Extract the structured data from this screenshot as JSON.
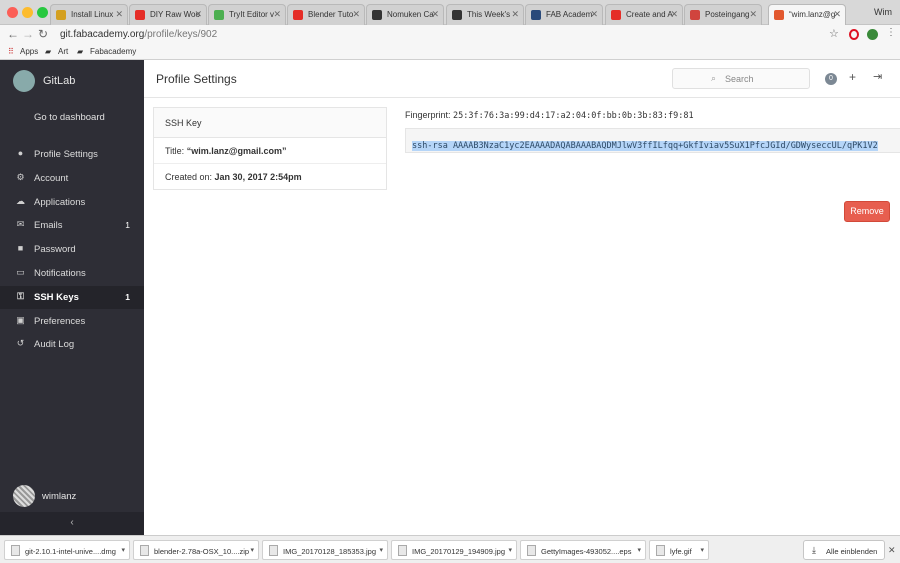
{
  "browser": {
    "tabs": [
      {
        "label": "Install Linux",
        "fav": "#d4a020"
      },
      {
        "label": "DIY Raw Woo",
        "fav": "#e52d27"
      },
      {
        "label": "TryIt Editor v",
        "fav": "#4caf50"
      },
      {
        "label": "Blender Tuto",
        "fav": "#e52d27"
      },
      {
        "label": "Nomuken Ca",
        "fav": "#333333"
      },
      {
        "label": "This Week's",
        "fav": "#333333"
      },
      {
        "label": "FAB Academ",
        "fav": "#2a4a7a"
      },
      {
        "label": "Create and A",
        "fav": "#e52d27"
      },
      {
        "label": "Posteingang",
        "fav": "#d0443e"
      },
      {
        "label": "“wim.lanz@g",
        "fav": "#e2582e"
      }
    ],
    "user": "Wim",
    "url_host": "git.fabacademy.org",
    "url_path": "/profile/keys/902",
    "bookmarks": [
      "Apps",
      "Art",
      "Fabacademy"
    ]
  },
  "sidebar": {
    "brand": "GitLab",
    "dashboard": "Go to dashboard",
    "items": [
      {
        "label": "Profile Settings",
        "icon": "user-icon",
        "glyph": "●",
        "badge": ""
      },
      {
        "label": "Account",
        "icon": "gear-icon",
        "glyph": "⚙",
        "badge": ""
      },
      {
        "label": "Applications",
        "icon": "cloud-icon",
        "glyph": "☁",
        "badge": ""
      },
      {
        "label": "Emails",
        "icon": "envelope-icon",
        "glyph": "✉",
        "badge": "1"
      },
      {
        "label": "Password",
        "icon": "lock-icon",
        "glyph": "■",
        "badge": ""
      },
      {
        "label": "Notifications",
        "icon": "inbox-icon",
        "glyph": "▭",
        "badge": ""
      },
      {
        "label": "SSH Keys",
        "icon": "key-icon",
        "glyph": "⚿",
        "badge": "1"
      },
      {
        "label": "Preferences",
        "icon": "image-icon",
        "glyph": "▣",
        "badge": ""
      },
      {
        "label": "Audit Log",
        "icon": "history-icon",
        "glyph": "↺",
        "badge": ""
      }
    ],
    "active_index": 6,
    "username": "wimlanz",
    "collapse": "‹"
  },
  "header": {
    "title": "Profile Settings",
    "search_placeholder": "Search",
    "todo_count": "0"
  },
  "ssh_key": {
    "panel_title": "SSH Key",
    "title_label": "Title:",
    "title_value": "“wim.lanz@gmail.com”",
    "created_label": "Created on:",
    "created_value": "Jan 30, 2017 2:54pm",
    "fingerprint_label": "Fingerprint:",
    "fingerprint": "25:3f:76:3a:99:d4:17:a2:04:0f:bb:0b:3b:83:f9:81",
    "key": "ssh-rsa AAAAB3NzaC1yc2EAAAADAQABAAABAQDMJlwV3ffILfqq+GkfIviav5SuX1PfcJGId/GDWyseccUL/qPK1V2",
    "remove_label": "Remove"
  },
  "downloads": {
    "items": [
      "git-2.10.1-intel-unive....dmg",
      "blender-2.78a-OSX_10....zip",
      "IMG_20170128_185353.jpg",
      "IMG_20170129_194909.jpg",
      "GettyImages-493052....eps",
      "lyfe.gif"
    ],
    "show_all": "Alle einblenden"
  }
}
